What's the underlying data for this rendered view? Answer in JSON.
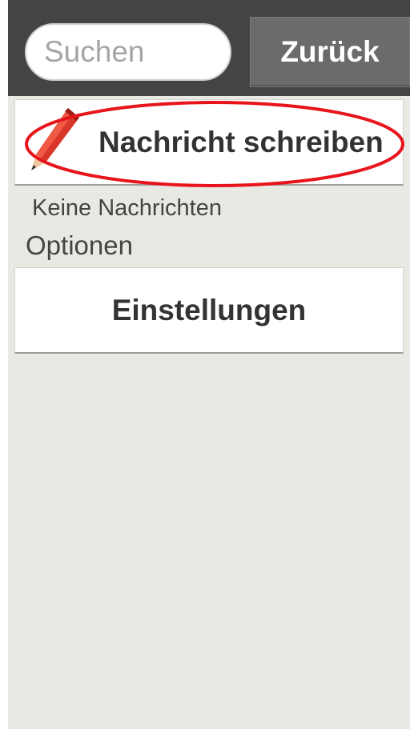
{
  "search": {
    "placeholder": "Suchen",
    "value": ""
  },
  "header": {
    "back_label": "Zurück"
  },
  "compose": {
    "label": "Nachricht schreiben",
    "icon": "pencil-icon"
  },
  "messages": {
    "empty_text": "Keine Nachrichten"
  },
  "options": {
    "section_label": "Optionen",
    "settings_label": "Einstellungen"
  },
  "colors": {
    "topbar": "#444444",
    "background": "#e9e9e4",
    "button": "#6b6b6b",
    "highlight": "#e8141c",
    "pencil": "#d9372b"
  }
}
